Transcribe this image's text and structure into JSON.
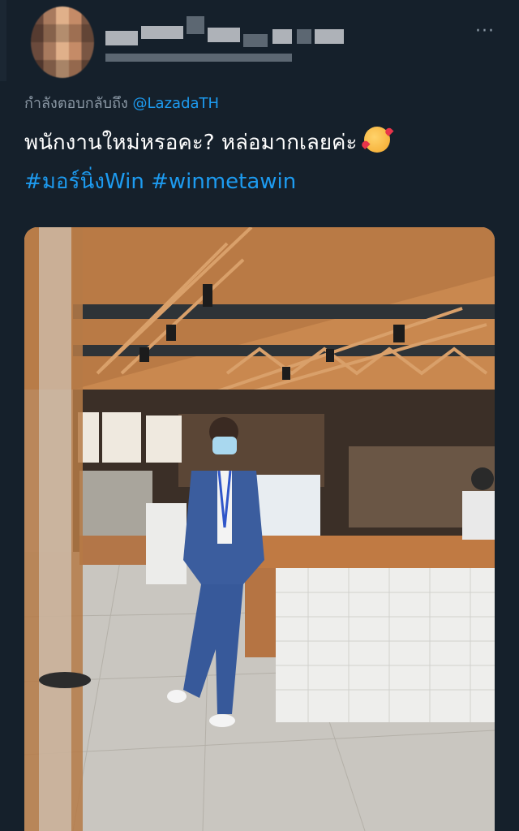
{
  "reply": {
    "prefix": "กำลังตอบกลับถึง",
    "mention": "@LazadaTH"
  },
  "tweet": {
    "text": "พนักงานใหม่หรอคะ? หล่อมากเลยค่ะ",
    "emoji": "smiling-face-with-hearts-emoji",
    "hashtags": [
      "#มอร์นิ่งWin",
      "#winmetawin"
    ]
  },
  "more_label": "···",
  "colors": {
    "background": "#15202b",
    "link": "#1d9bf0",
    "muted": "#8b98a5",
    "text": "#ffffff"
  }
}
